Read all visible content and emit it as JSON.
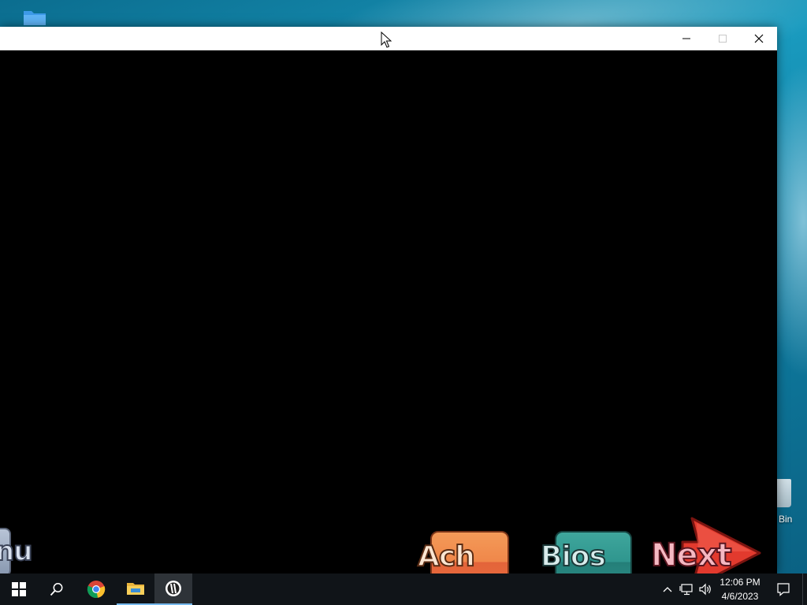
{
  "window": {
    "title": "",
    "controls": {
      "minimize": "minimize",
      "maximize": "maximize",
      "close": "close"
    }
  },
  "game": {
    "buttons": {
      "menu": "nu",
      "achievements": "Ach",
      "bios": "Bios",
      "next": "Next"
    },
    "colors": {
      "achievements": "#f0874a",
      "bios": "#2f968e",
      "next": "#e23a2e",
      "menu": "#9aa8bf"
    }
  },
  "desktop": {
    "recycle_bin_label": "Bin"
  },
  "taskbar": {
    "apps": [
      {
        "name": "start",
        "icon": "windows-logo-icon"
      },
      {
        "name": "search",
        "icon": "search-icon"
      },
      {
        "name": "chrome",
        "icon": "chrome-icon"
      },
      {
        "name": "file-explorer",
        "icon": "folder-icon"
      },
      {
        "name": "game",
        "icon": "game-app-icon"
      }
    ],
    "clock": {
      "time": "12:06 PM",
      "date": "4/6/2023"
    }
  }
}
